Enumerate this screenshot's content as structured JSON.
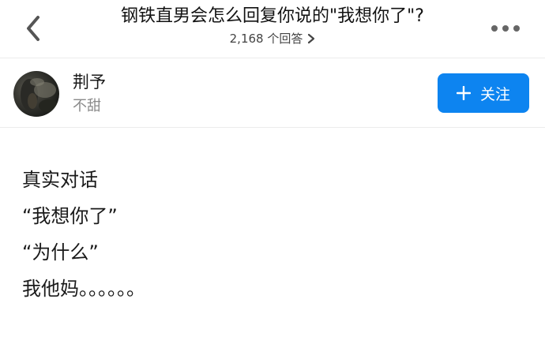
{
  "header": {
    "back_icon": "chevron-left-icon",
    "question_title": "钢铁直男会怎么回复你说的\"我想你了\"?",
    "answers_count": "2,168 个回答",
    "answers_chevron_icon": "chevron-right-icon",
    "more_icon": "more-dots-icon"
  },
  "author": {
    "name": "荆予",
    "bio": "不甜",
    "follow_label": "关注",
    "follow_icon": "plus-icon",
    "accent_color": "#0d84f0"
  },
  "answer": {
    "lines": [
      "真实对话",
      "“我想你了”",
      "“为什么”",
      "我他妈。。。。。。"
    ]
  }
}
